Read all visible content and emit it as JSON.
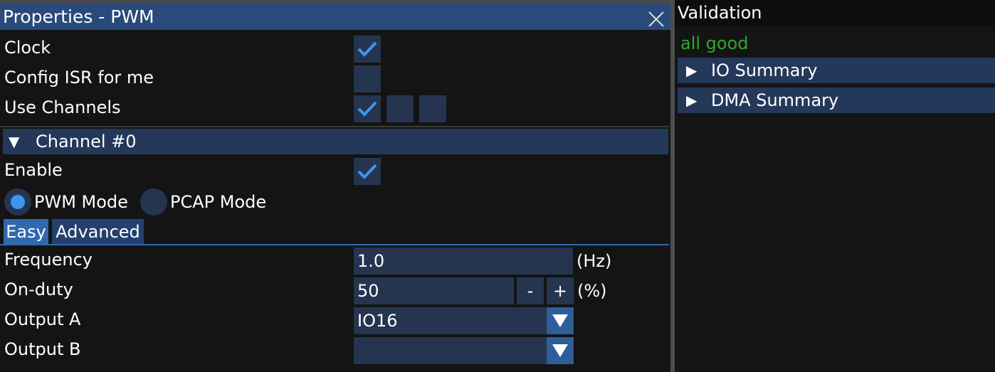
{
  "properties": {
    "title": "Properties - PWM",
    "rows": {
      "clock": "Clock",
      "config_isr": "Config ISR for me",
      "use_channels": "Use Channels"
    },
    "clock_checked": true,
    "config_isr_checked": false,
    "use_channels_checked": [
      true,
      false,
      false
    ],
    "channel": {
      "header": "Channel #0",
      "enable_label": "Enable",
      "enable_checked": true,
      "modes": {
        "pwm": "PWM Mode",
        "pcap": "PCAP Mode"
      },
      "selected_mode": "PWM Mode",
      "tabs": {
        "easy": "Easy",
        "advanced": "Advanced"
      },
      "active_tab": "Easy",
      "frequency": {
        "label": "Frequency",
        "value": "1.0",
        "unit": "(Hz)"
      },
      "on_duty": {
        "label": "On-duty",
        "value": "50",
        "minus": "-",
        "plus": "+",
        "unit": "(%)"
      },
      "output_a": {
        "label": "Output A",
        "value": "IO16"
      },
      "output_b": {
        "label": "Output B",
        "value": ""
      }
    }
  },
  "validation": {
    "title": "Validation",
    "status": "all good",
    "status_color": "#2ea82e",
    "sections": {
      "io": "IO Summary",
      "dma": "DMA Summary"
    }
  },
  "colors": {
    "title_bar": "#294a7a",
    "header": "#24385a",
    "control_bg": "#25354f",
    "accent": "#3d95f0",
    "tab_active": "#3169b0"
  }
}
